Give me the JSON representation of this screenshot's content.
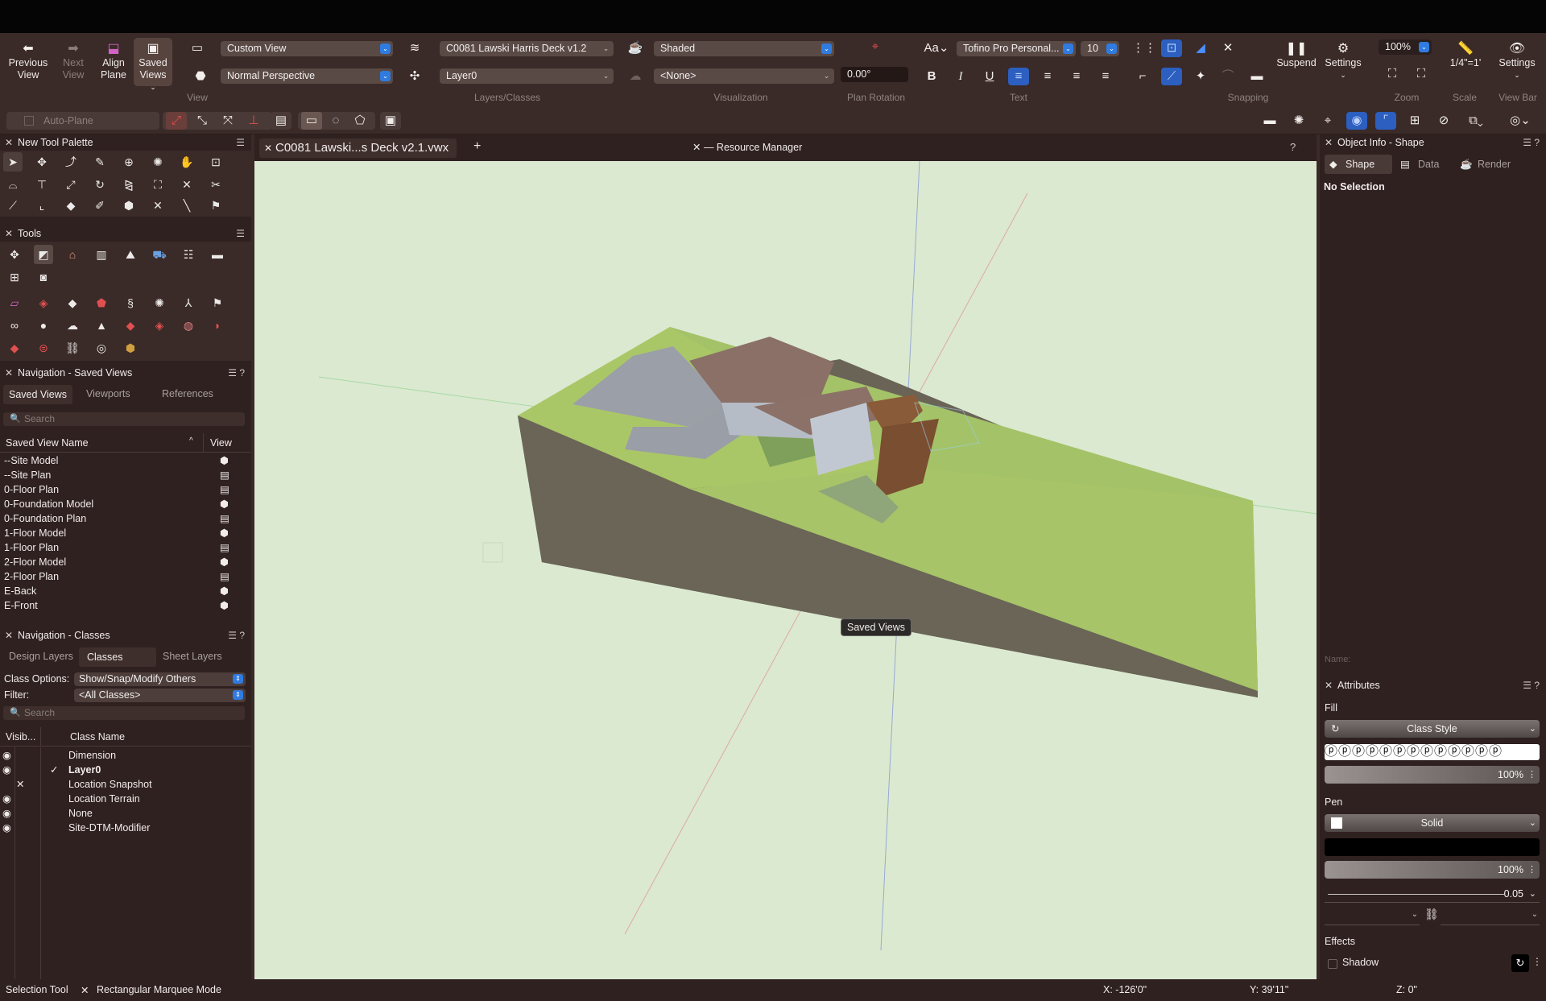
{
  "toolbar": {
    "previous_view": "Previous View",
    "next_view": "Next View",
    "align_plane": "Align Plane",
    "saved_views": "Saved Views",
    "view_select": "Custom View",
    "projection_select": "Normal Perspective",
    "group_view": "View",
    "layer_file_select": "C0081 Lawski Harris Deck v1.2",
    "layer_select": "Layer0",
    "group_layers_classes": "Layers/Classes",
    "render_select": "Shaded",
    "render_none_select": "<None>",
    "group_visualization": "Visualization",
    "plan_rotation_value": "0.00°",
    "group_plan_rotation": "Plan Rotation",
    "font_select": "Tofino Pro Personal...",
    "font_size_select": "10",
    "group_text": "Text",
    "group_snapping": "Snapping",
    "suspend": "Suspend",
    "settings": "Settings",
    "zoom_value": "100%",
    "group_zoom": "Zoom",
    "scale_value": "1/4\"=1'",
    "group_scale": "Scale",
    "viewbar_settings": "Settings",
    "group_view_bar": "View Bar",
    "auto_plane": "Auto-Plane"
  },
  "palettes": {
    "new_tool_palette_title": "New Tool Palette",
    "tools_title": "Tools",
    "nav_saved_views_title": "Navigation - Saved Views",
    "saved_view_tabs": [
      "Saved Views",
      "Viewports",
      "References"
    ],
    "search_placeholder": "Search",
    "saved_view_col_name": "Saved View Name",
    "saved_view_col_view": "View",
    "saved_views": [
      {
        "name": "--Site Model",
        "type": "model"
      },
      {
        "name": "--Site Plan",
        "type": "plan"
      },
      {
        "name": "0-Floor Plan",
        "type": "plan"
      },
      {
        "name": "0-Foundation Model",
        "type": "model"
      },
      {
        "name": "0-Foundation Plan",
        "type": "plan"
      },
      {
        "name": "1-Floor Model",
        "type": "model"
      },
      {
        "name": "1-Floor Plan",
        "type": "plan"
      },
      {
        "name": "2-Floor Model",
        "type": "model"
      },
      {
        "name": "2-Floor Plan",
        "type": "plan"
      },
      {
        "name": "E-Back",
        "type": "model"
      },
      {
        "name": "E-Front",
        "type": "model"
      }
    ],
    "nav_classes_title": "Navigation - Classes",
    "class_tabs": [
      "Design Layers",
      "Classes",
      "Sheet Layers"
    ],
    "class_options_label": "Class Options:",
    "class_options_value": "Show/Snap/Modify Others",
    "filter_label": "Filter:",
    "filter_value": "<All Classes>",
    "class_col_visibility": "Visib...",
    "class_col_name": "Class Name",
    "classes": [
      {
        "name": "Dimension",
        "vis": "eye",
        "active": false
      },
      {
        "name": "Layer0",
        "vis": "eye",
        "active": true
      },
      {
        "name": "Location Snapshot",
        "vis": "x",
        "active": false
      },
      {
        "name": "Location Terrain",
        "vis": "eye",
        "active": false
      },
      {
        "name": "None",
        "vis": "eye",
        "active": false
      },
      {
        "name": "Site-DTM-Modifier",
        "vis": "eye",
        "active": false
      }
    ]
  },
  "document": {
    "tab_title": "C0081 Lawski...s Deck v2.1.vwx",
    "add_tab": "+",
    "resource_manager": "Resource Manager",
    "help": "?",
    "tooltip": "Saved Views"
  },
  "object_info": {
    "title": "Object Info - Shape",
    "tabs": [
      "Shape",
      "Data",
      "Render"
    ],
    "no_selection": "No Selection",
    "name_label": "Name:"
  },
  "attributes": {
    "title": "Attributes",
    "fill_label": "Fill",
    "fill_style": "Class Style",
    "fill_opacity": "100%",
    "pen_label": "Pen",
    "pen_style": "Solid",
    "pen_opacity": "100%",
    "line_weight": "0.05",
    "effects_label": "Effects",
    "shadow_label": "Shadow"
  },
  "status": {
    "tool": "Selection Tool",
    "mode": "Rectangular Marquee Mode",
    "x": "X: -126'0\"",
    "y": "Y: 39'11\"",
    "z": "Z: 0\""
  },
  "colors": {
    "accent": "#2f7be0",
    "terrain_top": "#a9c66a",
    "terrain_side": "#6a6456",
    "canvas_bg": "#dbe9d0"
  }
}
